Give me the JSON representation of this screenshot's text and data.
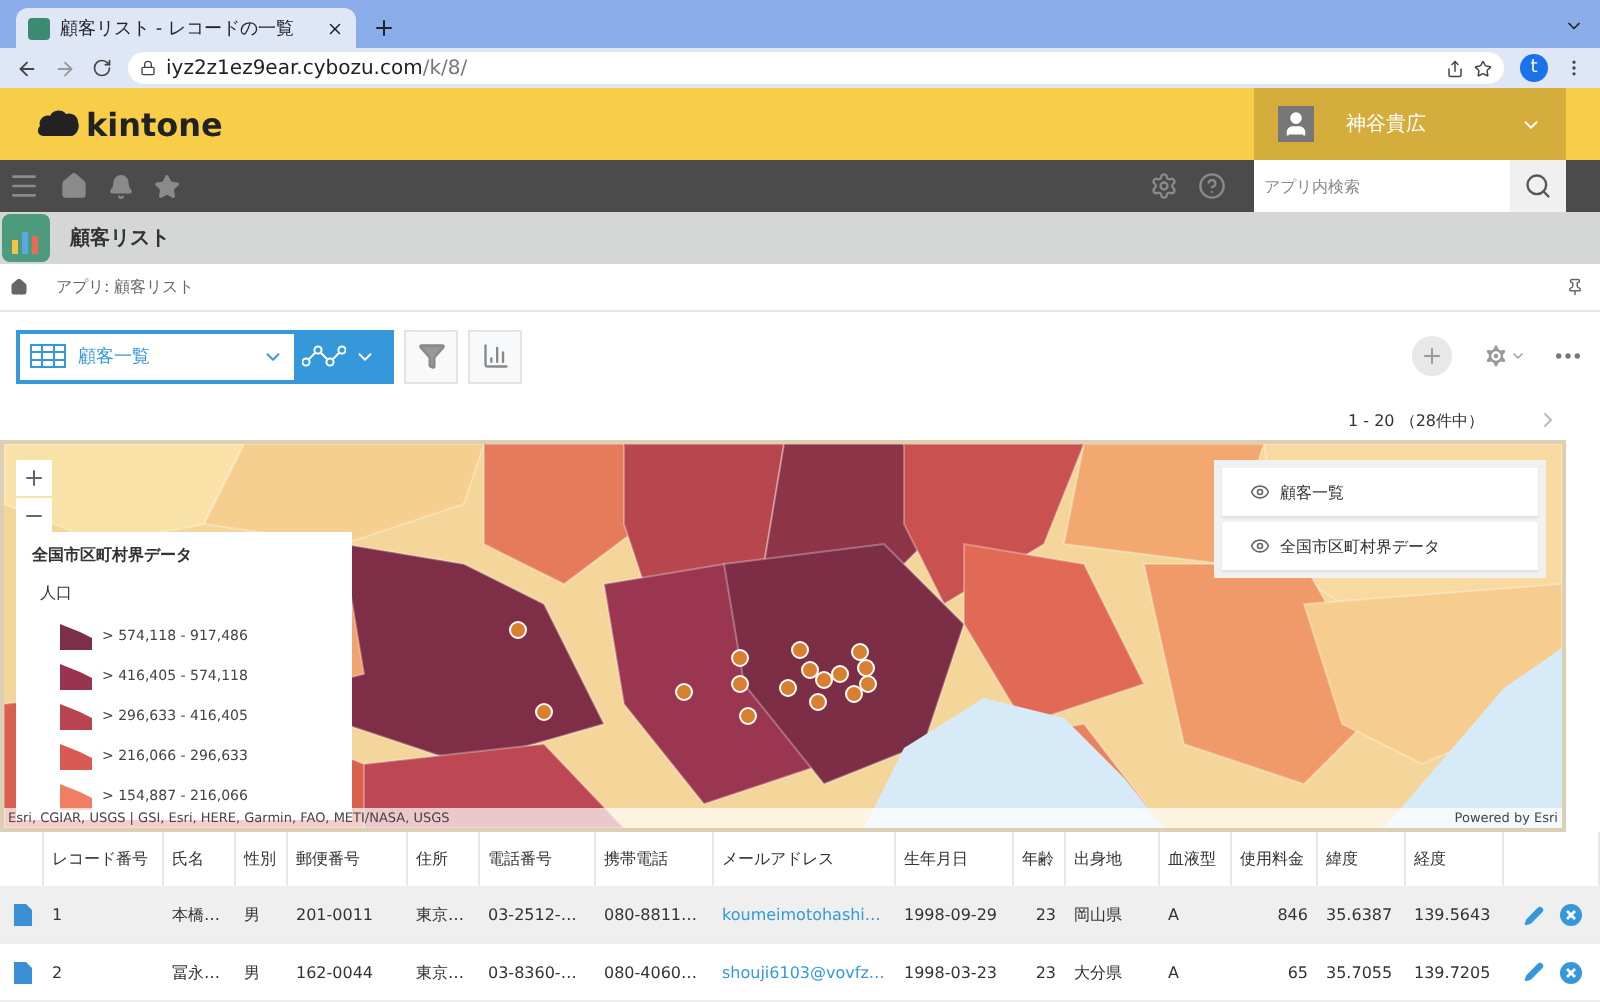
{
  "browser": {
    "tab_title": "顧客リスト - レコードの一覧",
    "url_host": "iyz2z1ez9ear.cybozu.com",
    "url_path": "/k/8/",
    "profile_letter": "t"
  },
  "header": {
    "logo": "kintone",
    "user_name": "神谷貴広"
  },
  "nav": {
    "search_placeholder": "アプリ内検索"
  },
  "app": {
    "title": "顧客リスト"
  },
  "breadcrumb": {
    "text": "アプリ: 顧客リスト"
  },
  "view": {
    "name": "顧客一覧"
  },
  "pagination": "1 - 20 （28件中）",
  "map": {
    "legend": {
      "title": "全国市区町村界データ",
      "subtitle": "人口",
      "items": [
        {
          "label": "> 574,118 - 917,486",
          "color": "#7b3048"
        },
        {
          "label": "> 416,405 - 574,118",
          "color": "#98344f"
        },
        {
          "label": "> 296,633 - 416,405",
          "color": "#b84351"
        },
        {
          "label": "> 216,066 - 296,633",
          "color": "#d85a52"
        },
        {
          "label": "> 154,887 - 216,066",
          "color": "#ee7f62"
        }
      ]
    },
    "layers": [
      {
        "label": "顧客一覧",
        "visible": true
      },
      {
        "label": "全国市区町村界データ",
        "visible": true
      }
    ],
    "attribution": "Esri, CGIAR, USGS | GSI, Esri, HERE, Garmin, FAO, METI/NASA, USGS",
    "powered_by": "Powered by Esri"
  },
  "table": {
    "columns": [
      {
        "label": "レコード番号",
        "kind": "text"
      },
      {
        "label": "氏名",
        "kind": "text"
      },
      {
        "label": "性別",
        "kind": "text"
      },
      {
        "label": "郵便番号",
        "kind": "text"
      },
      {
        "label": "住所",
        "kind": "text"
      },
      {
        "label": "電話番号",
        "kind": "text"
      },
      {
        "label": "携帯電話",
        "kind": "text"
      },
      {
        "label": "メールアドレス",
        "kind": "link"
      },
      {
        "label": "生年月日",
        "kind": "text"
      },
      {
        "label": "年齢",
        "kind": "number"
      },
      {
        "label": "出身地",
        "kind": "text"
      },
      {
        "label": "血液型",
        "kind": "text"
      },
      {
        "label": "使用料金",
        "kind": "number"
      },
      {
        "label": "緯度",
        "kind": "text"
      },
      {
        "label": "経度",
        "kind": "text"
      }
    ],
    "rows": [
      {
        "highlighted": true,
        "cells": [
          "1",
          "本橋…",
          "男",
          "201-0011",
          "東京…",
          "03-2512-…",
          "080-8811…",
          "koumeimotohashi…",
          "1998-09-29",
          "23",
          "岡山県",
          "A",
          "846",
          "35.6387",
          "139.5643"
        ]
      },
      {
        "highlighted": false,
        "cells": [
          "2",
          "冨永…",
          "男",
          "162-0044",
          "東京…",
          "03-8360-…",
          "080-4060…",
          "shouji6103@vovfz…",
          "1998-03-23",
          "23",
          "大分県",
          "A",
          "65",
          "35.7055",
          "139.7205"
        ]
      }
    ]
  }
}
